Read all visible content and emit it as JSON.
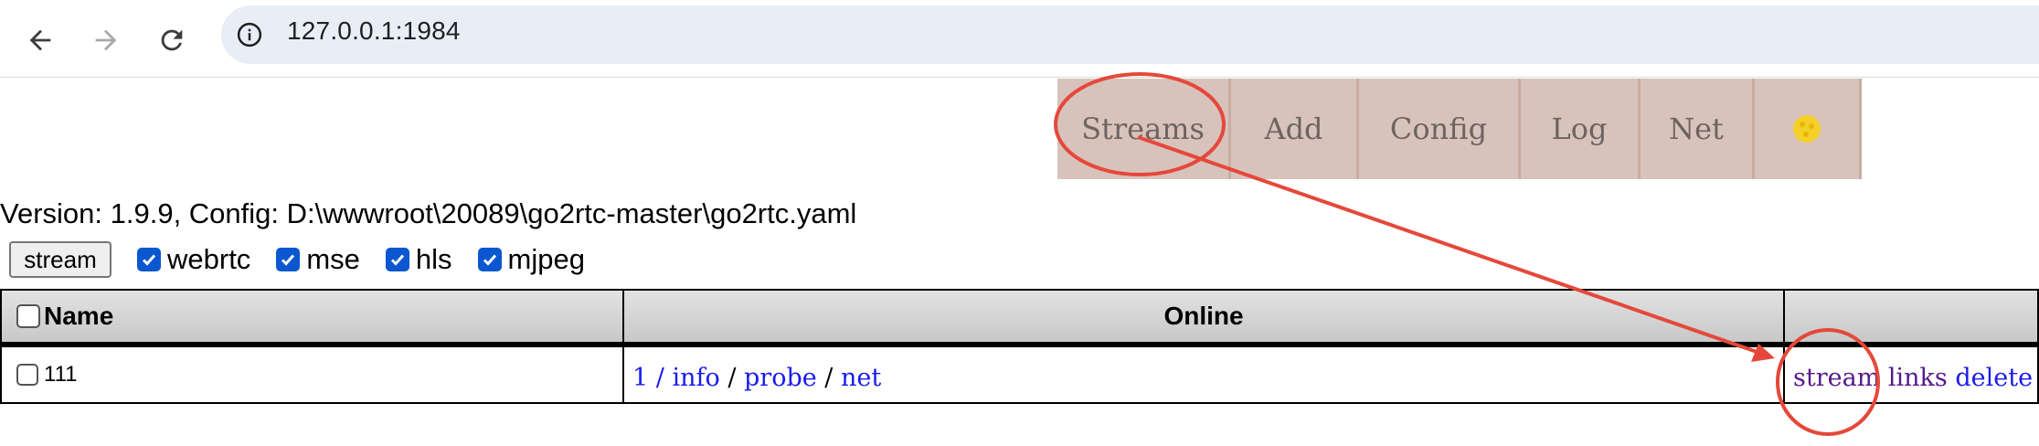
{
  "browser": {
    "url": "127.0.0.1:1984"
  },
  "nav": {
    "streams": "Streams",
    "add": "Add",
    "config": "Config",
    "log": "Log",
    "net": "Net",
    "theme_icon": "cookie-icon"
  },
  "version_line": "Version: 1.9.9, Config: D:\\wwwroot\\20089\\go2rtc-master\\go2rtc.yaml",
  "controls": {
    "stream_button": "stream",
    "options": [
      {
        "label": "webrtc",
        "checked": true
      },
      {
        "label": "mse",
        "checked": true
      },
      {
        "label": "hls",
        "checked": true
      },
      {
        "label": "mjpeg",
        "checked": true
      }
    ]
  },
  "table": {
    "headers": {
      "name": "Name",
      "online": "Online",
      "actions": ""
    },
    "rows": [
      {
        "name": "111",
        "online": {
          "count": "1",
          "sep1": " / ",
          "info": "info",
          "sep2": " / ",
          "probe": "probe",
          "sep3": " / ",
          "net": "net"
        },
        "actions": {
          "stream": "stream",
          "links": "links",
          "delete": "delete"
        }
      }
    ]
  },
  "colors": {
    "annotation": "#e5483a",
    "link": "#1a1aee",
    "visited_link": "#551a8b",
    "nav_bg": "#d8c3bc"
  }
}
